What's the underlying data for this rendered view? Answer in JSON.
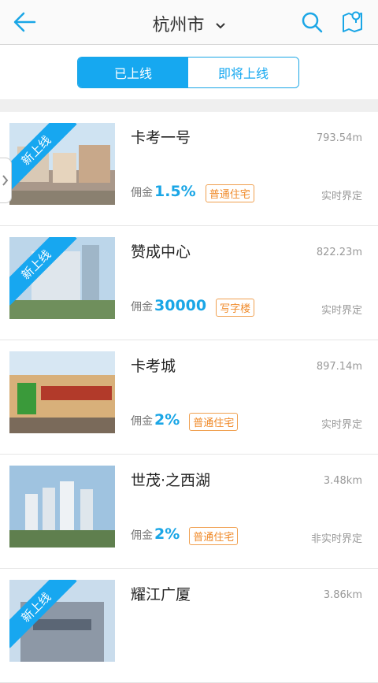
{
  "header": {
    "city": "杭州市",
    "icons": {
      "back": "back-arrow-icon",
      "search": "search-icon",
      "map": "map-location-icon",
      "chevron": "chevron-down-icon"
    }
  },
  "tabs": [
    {
      "label": "已上线",
      "active": true
    },
    {
      "label": "即将上线",
      "active": false
    }
  ],
  "labels": {
    "commission_prefix": "佣金"
  },
  "listings": [
    {
      "name": "卡考一号",
      "distance": "793.54m",
      "commission": "1.5%",
      "tag": "普通住宅",
      "status": "实时界定",
      "badge": "新上线"
    },
    {
      "name": "赞成中心",
      "distance": "822.23m",
      "commission": "30000",
      "tag": "写字楼",
      "status": "实时界定",
      "badge": "新上线"
    },
    {
      "name": "卡考城",
      "distance": "897.14m",
      "commission": "2%",
      "tag": "普通住宅",
      "status": "实时界定",
      "badge": ""
    },
    {
      "name": "世茂·之西湖",
      "distance": "3.48km",
      "commission": "2%",
      "tag": "普通住宅",
      "status": "非实时界定",
      "badge": ""
    },
    {
      "name": "耀江广厦",
      "distance": "3.86km",
      "commission": "",
      "tag": "",
      "status": "",
      "badge": "新上线"
    }
  ],
  "colors": {
    "accent": "#16a8f0",
    "tag": "#f08b2b"
  }
}
